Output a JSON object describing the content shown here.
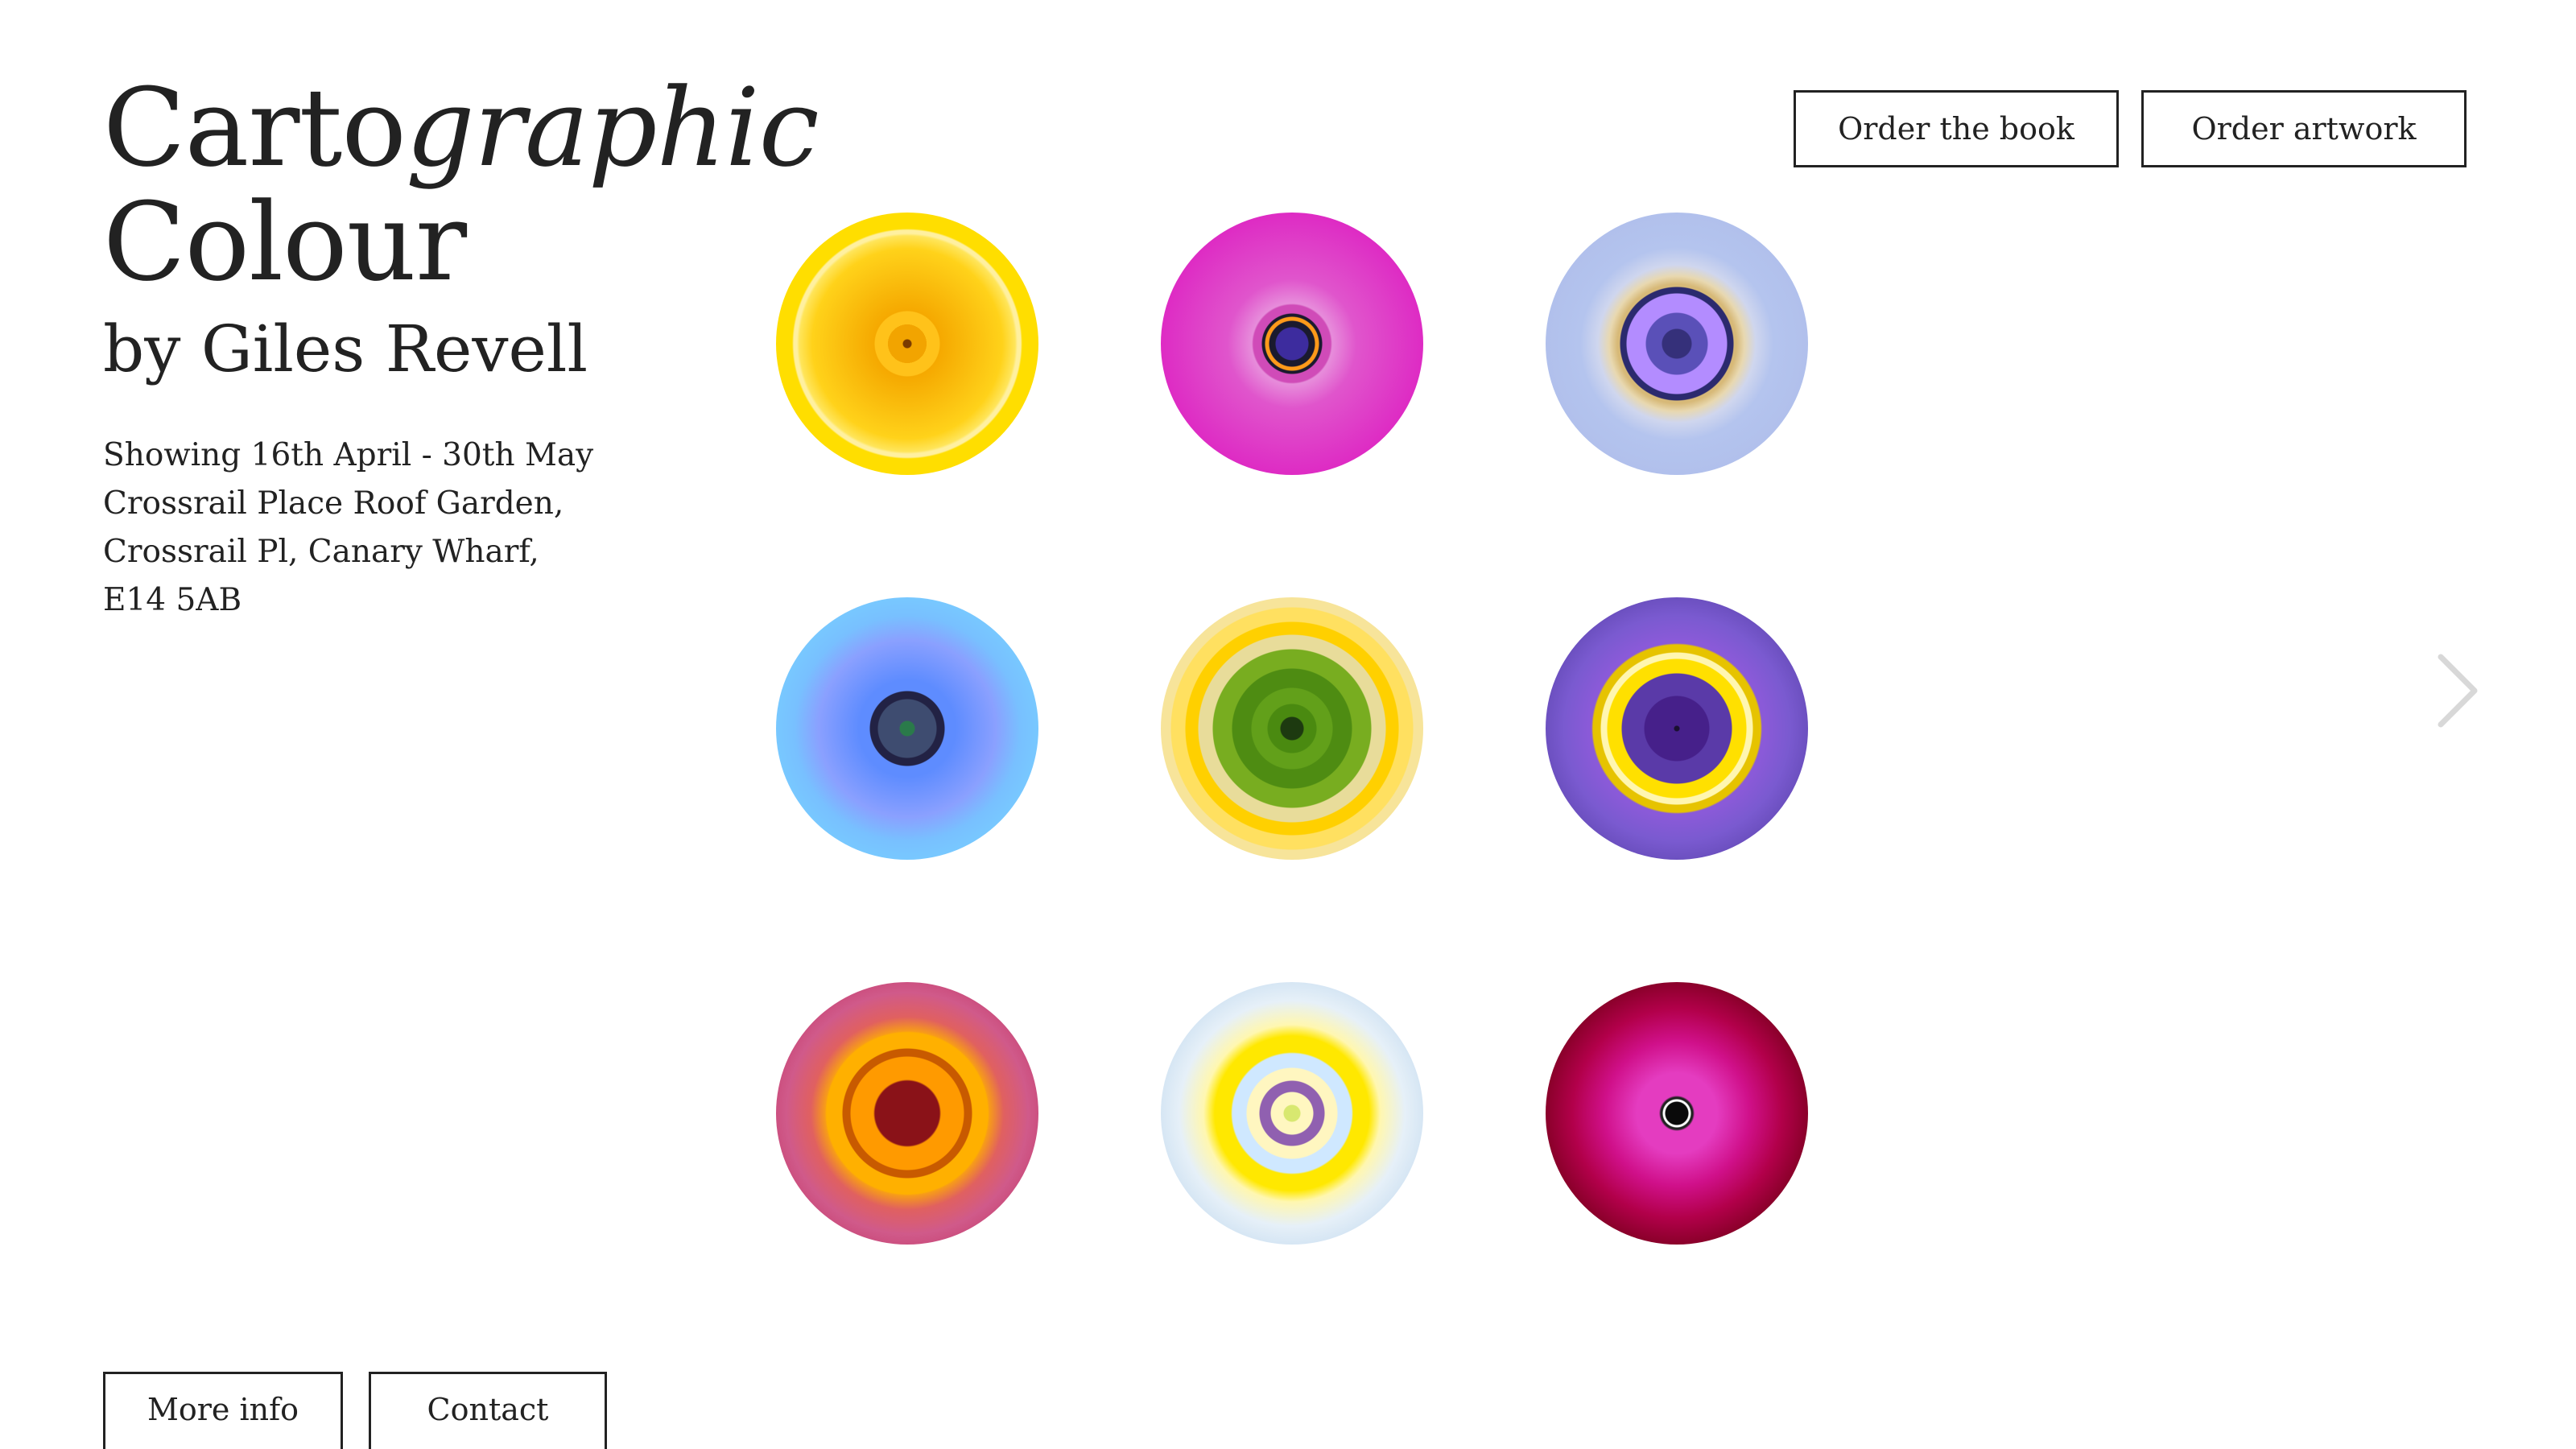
{
  "header": {
    "title_part1": "Carto",
    "title_part2": "graphic",
    "title_line2": "Colour",
    "byline": "by Giles Revell"
  },
  "details": [
    "Showing 16th April - 30th May",
    "Crossrail Place Roof Garden,",
    "Crossrail Pl, Canary Wharf,",
    "E14 5AB"
  ],
  "actions": {
    "order_book": "Order the book",
    "order_artwork": "Order artwork"
  },
  "footer": {
    "more_info": "More info",
    "contact": "Contact"
  },
  "artworks": [
    {
      "colour": "#ffde00"
    },
    {
      "colour": "#de2bc4"
    },
    {
      "colour": "#b1c0ec"
    },
    {
      "colour": "#78c8ff"
    },
    {
      "colour": "#f7e49a"
    },
    {
      "colour": "#6c50c0"
    },
    {
      "colour": "#cc5080"
    },
    {
      "colour": "#d6e6f4"
    },
    {
      "colour": "#8a002a"
    }
  ],
  "icons": {
    "next": "chevron-right-icon"
  }
}
